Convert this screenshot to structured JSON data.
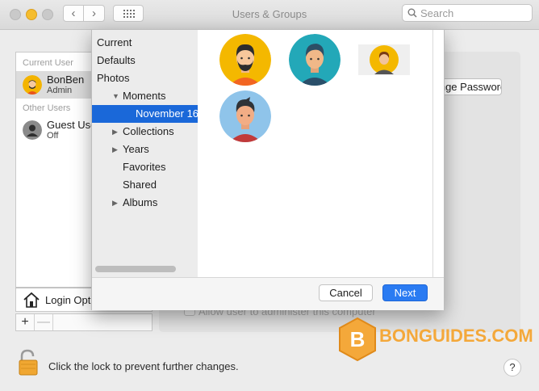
{
  "window": {
    "title": "Users & Groups"
  },
  "toolbar": {
    "back_icon": "chevron-left-icon",
    "forward_icon": "chevron-right-icon",
    "grid_icon": "grid-icon"
  },
  "search": {
    "placeholder": "Search"
  },
  "users": {
    "current_label": "Current User",
    "current": {
      "name": "BonBen",
      "role": "Admin"
    },
    "other_label": "Other Users",
    "others": [
      {
        "name": "Guest User",
        "role": "Off"
      }
    ],
    "login_options": "Login Options",
    "add_label": "+",
    "remove_label": "—"
  },
  "content": {
    "password_button": "Change Password...",
    "admin_checkbox": "Allow user to administer this computer"
  },
  "picture_sheet": {
    "sources": [
      {
        "label": "Current"
      },
      {
        "label": "Defaults"
      },
      {
        "label": "Photos"
      },
      {
        "label": "Moments"
      },
      {
        "label": "November 16"
      },
      {
        "label": "Collections"
      },
      {
        "label": "Years"
      },
      {
        "label": "Favorites"
      },
      {
        "label": "Shared"
      },
      {
        "label": "Albums"
      }
    ],
    "selected_source": "November 16",
    "cancel_label": "Cancel",
    "next_label": "Next"
  },
  "footer": {
    "lock_text": "Click the lock to prevent further changes.",
    "help_label": "?"
  },
  "watermark": {
    "text": "BONGUIDES.COM",
    "letter": "B"
  },
  "colors": {
    "accent": "#2a7bf2",
    "selection": "#1a68d9",
    "watermark": "#f4a83a"
  }
}
